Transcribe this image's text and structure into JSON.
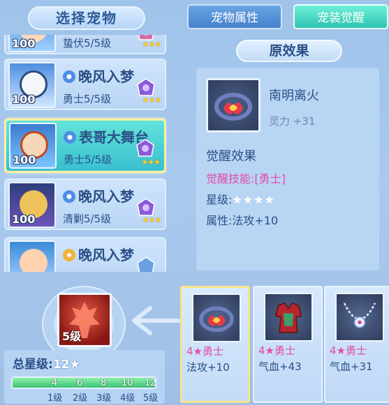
{
  "left_panel": {
    "title": "选择宠物",
    "pets": [
      {
        "level": "100",
        "name": "",
        "sub": "蛰伏5/5级",
        "stars": "★★★",
        "gem": "blue",
        "selected": false
      },
      {
        "level": "100",
        "name": "晚风入梦",
        "sub": "勇士5/5级",
        "stars": "★★★",
        "gem": "blue",
        "selected": false
      },
      {
        "level": "100",
        "name": "表哥大舞台",
        "sub": "勇士5/5级",
        "stars": "★★★",
        "gem": "blue",
        "selected": true
      },
      {
        "level": "100",
        "name": "晚风入梦",
        "sub": "清剿5/5级",
        "stars": "★★★",
        "gem": "blue",
        "selected": false
      },
      {
        "level": "",
        "name": "晚风入梦",
        "sub": "",
        "stars": "",
        "gem": "gold",
        "selected": false
      }
    ]
  },
  "skill": {
    "level": "5级",
    "icon": "warrior-skill-icon"
  },
  "star_progress": {
    "total_label": "总星级:",
    "total_value": "12★",
    "fill_fraction": 1.0,
    "ticks": [
      "4",
      "6",
      "8",
      "10",
      "12"
    ],
    "levels": [
      "1级",
      "2级",
      "3级",
      "4级",
      "5级"
    ]
  },
  "tabs": {
    "attributes": "宠物属性",
    "awaken": "宠装觉醒"
  },
  "original_effect": {
    "title": "原效果",
    "equip_name": "南明离火",
    "equip_stat": "灵力 +31",
    "awaken_title": "觉醒效果",
    "skill_label": "觉醒技能:",
    "skill_value": "[勇士]",
    "star_label": "星级:",
    "star_value": "★★★★",
    "attr_label": "属性:",
    "attr_value": "法攻+10"
  },
  "equipment": [
    {
      "quality": "4★勇士",
      "stat": "法攻+10",
      "icon": "fire-crown-icon",
      "selected": true
    },
    {
      "quality": "4★勇士",
      "stat": "气血+43",
      "icon": "red-armor-icon",
      "selected": false
    },
    {
      "quality": "4★勇士",
      "stat": "气血+31",
      "icon": "necklace-icon",
      "selected": false
    }
  ],
  "colors": {
    "accent_pink": "#e24aaa",
    "text_blue": "#2a4f86",
    "selected_border": "#fff1a4",
    "teal_tab": "#2dc3b2"
  }
}
